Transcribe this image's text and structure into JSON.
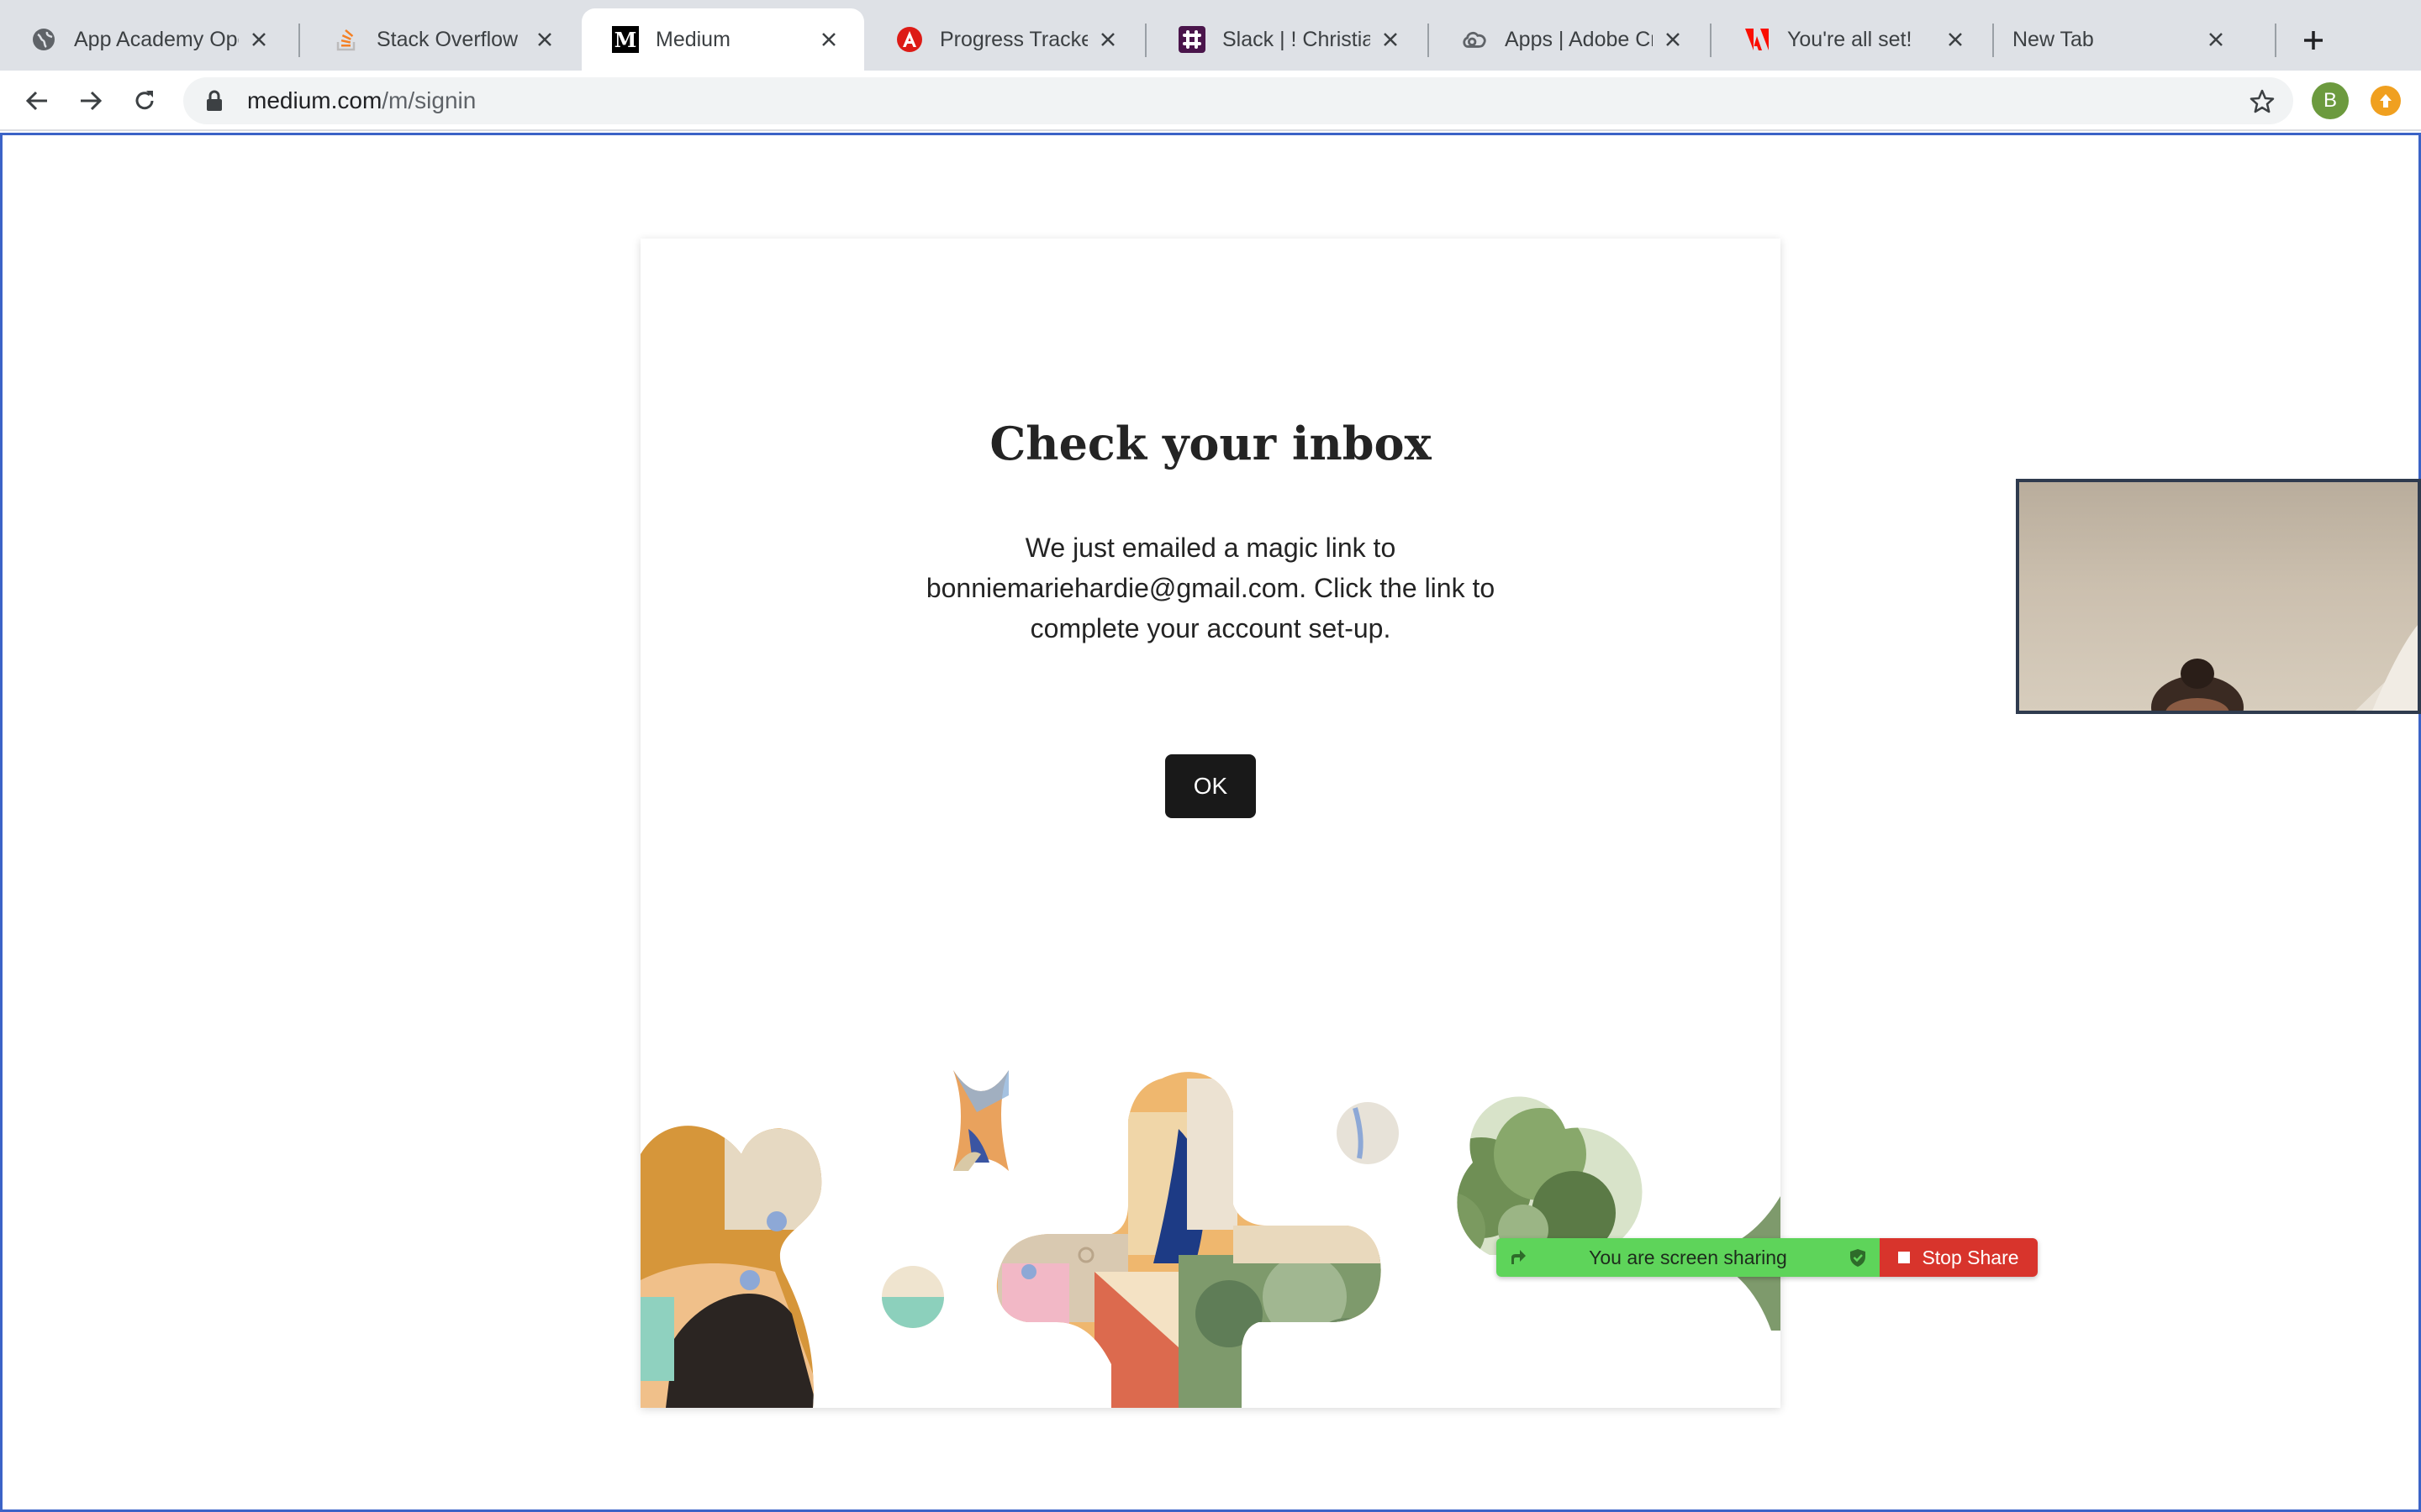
{
  "browser": {
    "tabs": [
      {
        "title": "App Academy Ope",
        "icon": "globe-icon"
      },
      {
        "title": "Stack Overflow - V",
        "icon": "stackoverflow-icon"
      },
      {
        "title": "Medium",
        "icon": "medium-icon",
        "active": true
      },
      {
        "title": "Progress Tracker",
        "icon": "angular-icon"
      },
      {
        "title": "Slack | ! Christian",
        "icon": "slack-icon"
      },
      {
        "title": "Apps | Adobe Crea",
        "icon": "creative-cloud-icon"
      },
      {
        "title": "You're all set!",
        "icon": "adobe-icon"
      },
      {
        "title": "New Tab",
        "icon": ""
      }
    ],
    "address": {
      "host": "medium.com",
      "path": "/m/signin"
    },
    "profile_initial": "B"
  },
  "card": {
    "title": "Check your inbox",
    "message": "We just emailed a magic link to bonniemariehardie@gmail.com. Click the link to complete your account set-up.",
    "ok_label": "OK"
  },
  "screen_share": {
    "status": "You are screen sharing",
    "stop_label": "Stop Share"
  },
  "colors": {
    "accent_frame": "#3b63c7",
    "ok_button": "#191919",
    "share_green": "#5ed45a",
    "share_red": "#d8342c"
  }
}
